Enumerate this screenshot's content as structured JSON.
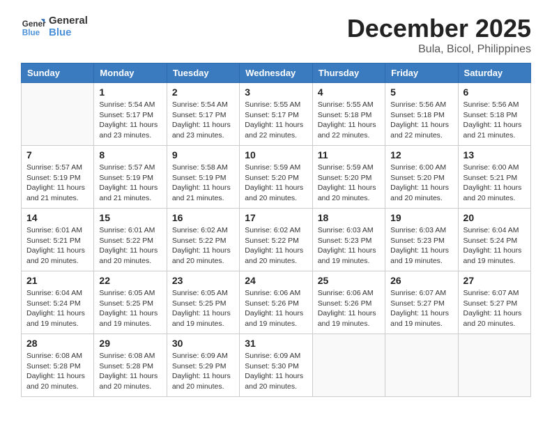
{
  "header": {
    "logo_text_general": "General",
    "logo_text_blue": "Blue",
    "month_year": "December 2025",
    "location": "Bula, Bicol, Philippines"
  },
  "calendar": {
    "days_of_week": [
      "Sunday",
      "Monday",
      "Tuesday",
      "Wednesday",
      "Thursday",
      "Friday",
      "Saturday"
    ],
    "weeks": [
      [
        {
          "day": "",
          "info": ""
        },
        {
          "day": "1",
          "info": "Sunrise: 5:54 AM\nSunset: 5:17 PM\nDaylight: 11 hours\nand 23 minutes."
        },
        {
          "day": "2",
          "info": "Sunrise: 5:54 AM\nSunset: 5:17 PM\nDaylight: 11 hours\nand 23 minutes."
        },
        {
          "day": "3",
          "info": "Sunrise: 5:55 AM\nSunset: 5:17 PM\nDaylight: 11 hours\nand 22 minutes."
        },
        {
          "day": "4",
          "info": "Sunrise: 5:55 AM\nSunset: 5:18 PM\nDaylight: 11 hours\nand 22 minutes."
        },
        {
          "day": "5",
          "info": "Sunrise: 5:56 AM\nSunset: 5:18 PM\nDaylight: 11 hours\nand 22 minutes."
        },
        {
          "day": "6",
          "info": "Sunrise: 5:56 AM\nSunset: 5:18 PM\nDaylight: 11 hours\nand 21 minutes."
        }
      ],
      [
        {
          "day": "7",
          "info": "Sunrise: 5:57 AM\nSunset: 5:19 PM\nDaylight: 11 hours\nand 21 minutes."
        },
        {
          "day": "8",
          "info": "Sunrise: 5:57 AM\nSunset: 5:19 PM\nDaylight: 11 hours\nand 21 minutes."
        },
        {
          "day": "9",
          "info": "Sunrise: 5:58 AM\nSunset: 5:19 PM\nDaylight: 11 hours\nand 21 minutes."
        },
        {
          "day": "10",
          "info": "Sunrise: 5:59 AM\nSunset: 5:20 PM\nDaylight: 11 hours\nand 20 minutes."
        },
        {
          "day": "11",
          "info": "Sunrise: 5:59 AM\nSunset: 5:20 PM\nDaylight: 11 hours\nand 20 minutes."
        },
        {
          "day": "12",
          "info": "Sunrise: 6:00 AM\nSunset: 5:20 PM\nDaylight: 11 hours\nand 20 minutes."
        },
        {
          "day": "13",
          "info": "Sunrise: 6:00 AM\nSunset: 5:21 PM\nDaylight: 11 hours\nand 20 minutes."
        }
      ],
      [
        {
          "day": "14",
          "info": "Sunrise: 6:01 AM\nSunset: 5:21 PM\nDaylight: 11 hours\nand 20 minutes."
        },
        {
          "day": "15",
          "info": "Sunrise: 6:01 AM\nSunset: 5:22 PM\nDaylight: 11 hours\nand 20 minutes."
        },
        {
          "day": "16",
          "info": "Sunrise: 6:02 AM\nSunset: 5:22 PM\nDaylight: 11 hours\nand 20 minutes."
        },
        {
          "day": "17",
          "info": "Sunrise: 6:02 AM\nSunset: 5:22 PM\nDaylight: 11 hours\nand 20 minutes."
        },
        {
          "day": "18",
          "info": "Sunrise: 6:03 AM\nSunset: 5:23 PM\nDaylight: 11 hours\nand 19 minutes."
        },
        {
          "day": "19",
          "info": "Sunrise: 6:03 AM\nSunset: 5:23 PM\nDaylight: 11 hours\nand 19 minutes."
        },
        {
          "day": "20",
          "info": "Sunrise: 6:04 AM\nSunset: 5:24 PM\nDaylight: 11 hours\nand 19 minutes."
        }
      ],
      [
        {
          "day": "21",
          "info": "Sunrise: 6:04 AM\nSunset: 5:24 PM\nDaylight: 11 hours\nand 19 minutes."
        },
        {
          "day": "22",
          "info": "Sunrise: 6:05 AM\nSunset: 5:25 PM\nDaylight: 11 hours\nand 19 minutes."
        },
        {
          "day": "23",
          "info": "Sunrise: 6:05 AM\nSunset: 5:25 PM\nDaylight: 11 hours\nand 19 minutes."
        },
        {
          "day": "24",
          "info": "Sunrise: 6:06 AM\nSunset: 5:26 PM\nDaylight: 11 hours\nand 19 minutes."
        },
        {
          "day": "25",
          "info": "Sunrise: 6:06 AM\nSunset: 5:26 PM\nDaylight: 11 hours\nand 19 minutes."
        },
        {
          "day": "26",
          "info": "Sunrise: 6:07 AM\nSunset: 5:27 PM\nDaylight: 11 hours\nand 19 minutes."
        },
        {
          "day": "27",
          "info": "Sunrise: 6:07 AM\nSunset: 5:27 PM\nDaylight: 11 hours\nand 20 minutes."
        }
      ],
      [
        {
          "day": "28",
          "info": "Sunrise: 6:08 AM\nSunset: 5:28 PM\nDaylight: 11 hours\nand 20 minutes."
        },
        {
          "day": "29",
          "info": "Sunrise: 6:08 AM\nSunset: 5:28 PM\nDaylight: 11 hours\nand 20 minutes."
        },
        {
          "day": "30",
          "info": "Sunrise: 6:09 AM\nSunset: 5:29 PM\nDaylight: 11 hours\nand 20 minutes."
        },
        {
          "day": "31",
          "info": "Sunrise: 6:09 AM\nSunset: 5:30 PM\nDaylight: 11 hours\nand 20 minutes."
        },
        {
          "day": "",
          "info": ""
        },
        {
          "day": "",
          "info": ""
        },
        {
          "day": "",
          "info": ""
        }
      ]
    ]
  }
}
